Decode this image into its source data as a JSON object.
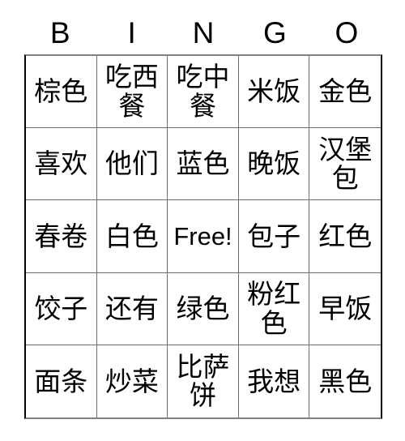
{
  "card": {
    "title": "BINGO",
    "header_letters": [
      "B",
      "I",
      "N",
      "G",
      "O"
    ],
    "free_space_label": "Free!",
    "colors": {
      "background": "#ffffff",
      "text": "#000000",
      "grid_line": "#6e6e6e",
      "border": "#000000"
    },
    "grid": {
      "rows": 5,
      "columns": 5,
      "cells": [
        [
          {
            "text": "棕色",
            "script": "han"
          },
          {
            "text": "吃西餐",
            "script": "han"
          },
          {
            "text": "吃中餐",
            "script": "han"
          },
          {
            "text": "米饭",
            "script": "han"
          },
          {
            "text": "金色",
            "script": "han"
          }
        ],
        [
          {
            "text": "喜欢",
            "script": "han"
          },
          {
            "text": "他们",
            "script": "han"
          },
          {
            "text": "蓝色",
            "script": "han"
          },
          {
            "text": "晚饭",
            "script": "han"
          },
          {
            "text": "汉堡包",
            "script": "han"
          }
        ],
        [
          {
            "text": "春卷",
            "script": "han"
          },
          {
            "text": "白色",
            "script": "han"
          },
          {
            "text": "Free!",
            "script": "latin"
          },
          {
            "text": "包子",
            "script": "han"
          },
          {
            "text": "红色",
            "script": "han"
          }
        ],
        [
          {
            "text": "饺子",
            "script": "han"
          },
          {
            "text": "还有",
            "script": "han"
          },
          {
            "text": "绿色",
            "script": "han"
          },
          {
            "text": "粉红色",
            "script": "han"
          },
          {
            "text": "早饭",
            "script": "han"
          }
        ],
        [
          {
            "text": "面条",
            "script": "han"
          },
          {
            "text": "炒菜",
            "script": "han"
          },
          {
            "text": "比萨饼",
            "script": "han"
          },
          {
            "text": "我想",
            "script": "han"
          },
          {
            "text": "黑色",
            "script": "han"
          }
        ]
      ]
    }
  }
}
